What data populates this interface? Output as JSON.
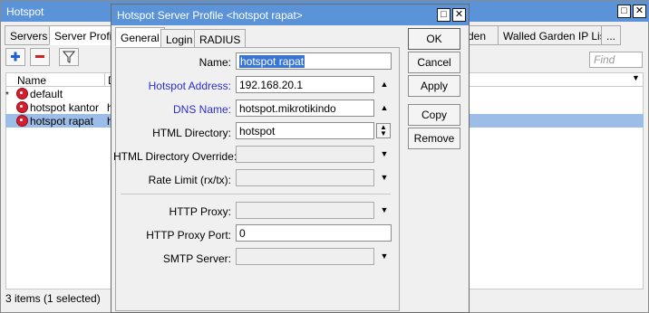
{
  "background_window": {
    "title": "Hotspot",
    "tabs": [
      "Servers",
      "Server Profile",
      "Walled Garden",
      "Walled Garden IP List",
      "..."
    ],
    "visible_tab_fragment": "rden",
    "find_placeholder": "Find",
    "column_name": "Name",
    "column_d_fragment": "D",
    "rows": [
      {
        "marker": "*",
        "name": "default",
        "d": ""
      },
      {
        "marker": "",
        "name": "hotspot kantor",
        "d": "h"
      },
      {
        "marker": "",
        "name": "hotspot rapat",
        "d": "h"
      }
    ],
    "status": "3 items (1 selected)"
  },
  "dialog": {
    "title": "Hotspot Server Profile <hotspot rapat>",
    "tabs": [
      "General",
      "Login",
      "RADIUS"
    ],
    "fields": {
      "name": {
        "label": "Name:",
        "value": "hotspot rapat"
      },
      "hotspot_address": {
        "label": "Hotspot Address:",
        "value": "192.168.20.1"
      },
      "dns_name": {
        "label": "DNS Name:",
        "value": "hotspot.mikrotikindo"
      },
      "html_directory": {
        "label": "HTML Directory:",
        "value": "hotspot"
      },
      "html_directory_override": {
        "label": "HTML Directory Override:",
        "value": ""
      },
      "rate_limit": {
        "label": "Rate Limit (rx/tx):",
        "value": ""
      },
      "http_proxy": {
        "label": "HTTP Proxy:",
        "value": ""
      },
      "http_proxy_port": {
        "label": "HTTP Proxy Port:",
        "value": "0"
      },
      "smtp_server": {
        "label": "SMTP Server:",
        "value": ""
      }
    },
    "buttons": {
      "ok": "OK",
      "cancel": "Cancel",
      "apply": "Apply",
      "copy": "Copy",
      "remove": "Remove"
    }
  },
  "colors": {
    "titlebar": "#5a93d8",
    "selection": "#9dbde9",
    "blue_label": "#2d2dcf",
    "selected_text_bg": "#3875d7"
  }
}
